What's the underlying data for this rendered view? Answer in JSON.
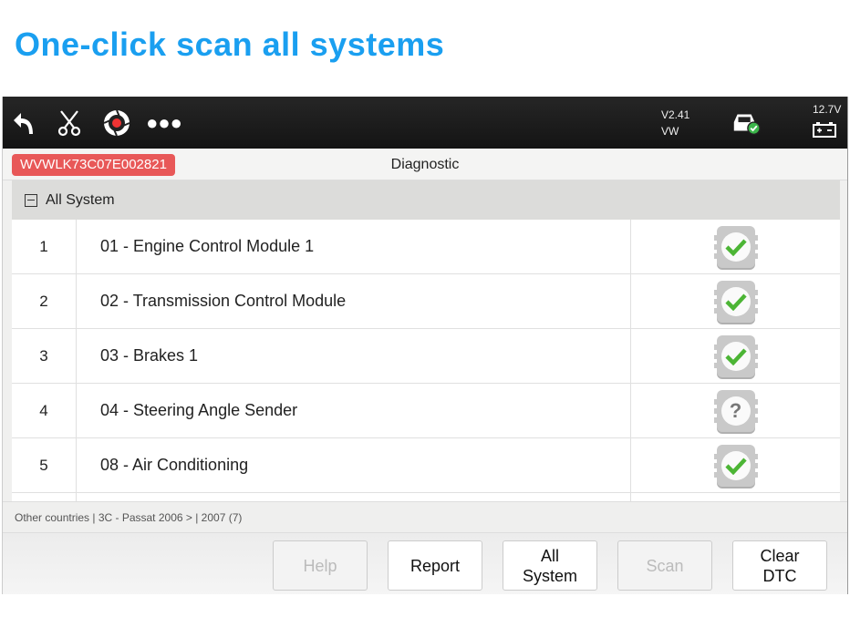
{
  "headline": "One-click scan all systems",
  "topbar": {
    "icons": [
      "back-icon",
      "scissors-icon",
      "camera-shutter-icon",
      "more-icon"
    ],
    "version": "V2.41",
    "make": "VW",
    "voltage": "12.7V"
  },
  "header": {
    "vin": "WVWLK73C07E002821",
    "title": "Diagnostic"
  },
  "group": {
    "label": "All System"
  },
  "rows": [
    {
      "no": "1",
      "name": "01 - Engine Control Module 1",
      "status": "ok"
    },
    {
      "no": "2",
      "name": "02 - Transmission Control Module",
      "status": "ok"
    },
    {
      "no": "3",
      "name": "03 - Brakes 1",
      "status": "ok"
    },
    {
      "no": "4",
      "name": "04 - Steering Angle Sender",
      "status": "unknown"
    },
    {
      "no": "5",
      "name": "08 - Air Conditioning",
      "status": "ok"
    }
  ],
  "status_bar": "Other countries | 3C - Passat 2006 > | 2007 (7)",
  "buttons": [
    {
      "label": "Help",
      "enabled": false
    },
    {
      "label": "Report",
      "enabled": true
    },
    {
      "label": "All\nSystem",
      "enabled": true
    },
    {
      "label": "Scan",
      "enabled": false
    },
    {
      "label": "Clear\nDTC",
      "enabled": true
    }
  ],
  "colors": {
    "accent": "#1a9ff0",
    "vin_badge": "#e85858",
    "ok_check": "#4cb535"
  }
}
